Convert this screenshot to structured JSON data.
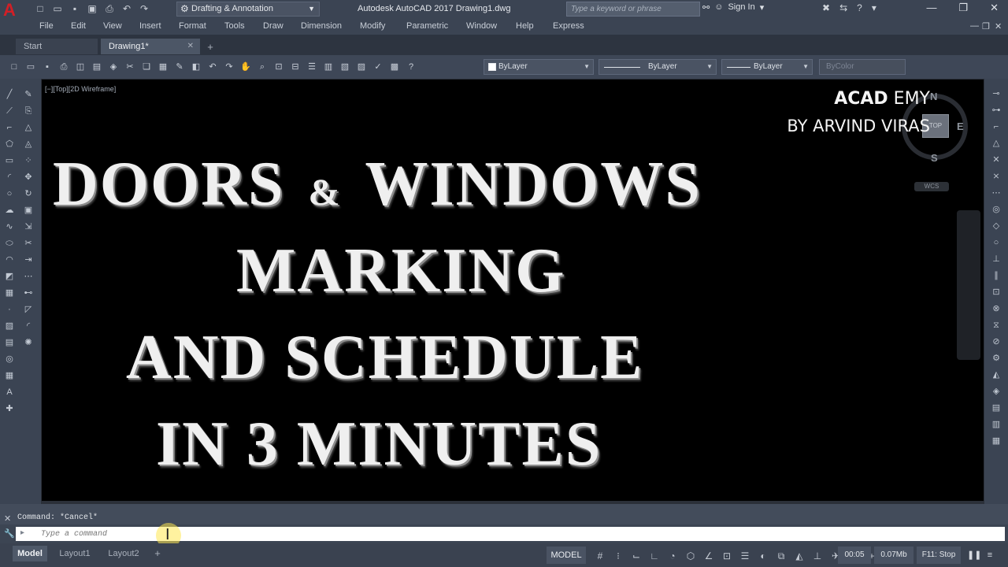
{
  "titlebar": {
    "app_logo": "A",
    "workspace": "Drafting & Annotation",
    "window_title": "Autodesk AutoCAD 2017   Drawing1.dwg",
    "search_placeholder": "Type a keyword or phrase",
    "signin": "Sign In",
    "qat_icons": [
      "new-icon",
      "open-icon",
      "save-icon",
      "saveas-icon",
      "print-icon",
      "undo-icon",
      "redo-icon"
    ]
  },
  "menus": [
    "File",
    "Edit",
    "View",
    "Insert",
    "Format",
    "Tools",
    "Draw",
    "Dimension",
    "Modify",
    "Parametric",
    "Window",
    "Help",
    "Express"
  ],
  "tabs": {
    "start": "Start",
    "drawing": "Drawing1*"
  },
  "properties": {
    "layer": "ByLayer",
    "linetype": "ByLayer",
    "lineweight": "ByLayer",
    "color": "ByColor"
  },
  "viewport": {
    "label": "[−][Top][2D Wireframe]",
    "watermark_bold": "ACAD",
    "watermark_rest": " EMY",
    "watermark_line2": "BY ARVIND VIRAS",
    "viewcube": {
      "n": "N",
      "s": "S",
      "e": "E",
      "face": "TOP",
      "wcs": "WCS"
    },
    "headline": {
      "line1a": "DOORS",
      "amp": "&",
      "line1b": "WINDOWS",
      "line2": "MARKING",
      "line3": "AND  SCHEDULE",
      "line4": "IN  3  MINUTES"
    }
  },
  "command": {
    "history": "Command: *Cancel*",
    "placeholder": "Type a command"
  },
  "layouts": {
    "model": "Model",
    "layout1": "Layout1",
    "layout2": "Layout2",
    "add": "+"
  },
  "status": {
    "model": "MODEL",
    "time": "00:05",
    "memory": "0.07Mb",
    "f11": "F11: Stop"
  }
}
